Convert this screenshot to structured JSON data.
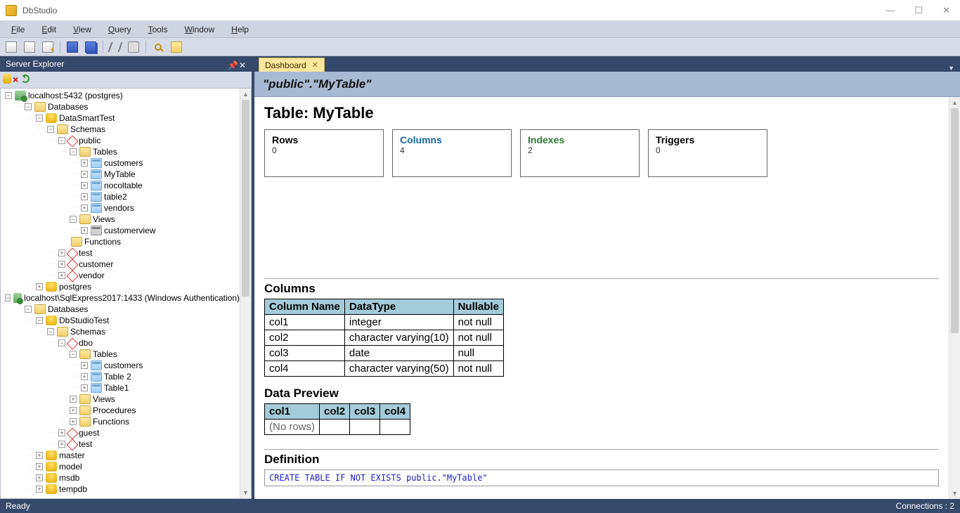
{
  "app": {
    "title": "DbStudio"
  },
  "menubar": [
    "File",
    "Edit",
    "View",
    "Query",
    "Tools",
    "Window",
    "Help"
  ],
  "explorer": {
    "title": "Server Explorer",
    "tree": [
      {
        "depth": 0,
        "toggle": "-",
        "icon": "server",
        "label": "localhost:5432 (postgres)"
      },
      {
        "depth": 1,
        "toggle": "-",
        "icon": "folder-open",
        "label": "Databases"
      },
      {
        "depth": 2,
        "toggle": "-",
        "icon": "db",
        "label": "DataSmartTest"
      },
      {
        "depth": 3,
        "toggle": "-",
        "icon": "folder-open",
        "label": "Schemas"
      },
      {
        "depth": 4,
        "toggle": "-",
        "icon": "schema",
        "label": "public"
      },
      {
        "depth": 5,
        "toggle": "-",
        "icon": "folder-open",
        "label": "Tables"
      },
      {
        "depth": 6,
        "toggle": "+",
        "icon": "table",
        "label": "customers"
      },
      {
        "depth": 6,
        "toggle": "+",
        "icon": "table",
        "label": "MyTable"
      },
      {
        "depth": 6,
        "toggle": "+",
        "icon": "table",
        "label": "nocoltable"
      },
      {
        "depth": 6,
        "toggle": "+",
        "icon": "table",
        "label": "table2"
      },
      {
        "depth": 6,
        "toggle": "+",
        "icon": "table",
        "label": "vendors"
      },
      {
        "depth": 5,
        "toggle": "-",
        "icon": "folder-open",
        "label": "Views"
      },
      {
        "depth": 6,
        "toggle": "+",
        "icon": "view",
        "label": "customerview"
      },
      {
        "depth": 5,
        "toggle": "",
        "icon": "folder",
        "label": "Functions"
      },
      {
        "depth": 4,
        "toggle": "+",
        "icon": "schema",
        "label": "test"
      },
      {
        "depth": 4,
        "toggle": "+",
        "icon": "schema",
        "label": "customer"
      },
      {
        "depth": 4,
        "toggle": "+",
        "icon": "schema",
        "label": "vendor"
      },
      {
        "depth": 2,
        "toggle": "+",
        "icon": "db",
        "label": "postgres"
      },
      {
        "depth": 0,
        "toggle": "-",
        "icon": "server",
        "label": "localhost\\SqlExpress2017:1433 (Windows Authentication)"
      },
      {
        "depth": 1,
        "toggle": "-",
        "icon": "folder-open",
        "label": "Databases"
      },
      {
        "depth": 2,
        "toggle": "-",
        "icon": "db",
        "label": "DbStudioTest"
      },
      {
        "depth": 3,
        "toggle": "-",
        "icon": "folder-open",
        "label": "Schemas"
      },
      {
        "depth": 4,
        "toggle": "-",
        "icon": "schema",
        "label": "dbo"
      },
      {
        "depth": 5,
        "toggle": "-",
        "icon": "folder-open",
        "label": "Tables"
      },
      {
        "depth": 6,
        "toggle": "+",
        "icon": "table",
        "label": "customers"
      },
      {
        "depth": 6,
        "toggle": "+",
        "icon": "table",
        "label": "Table 2"
      },
      {
        "depth": 6,
        "toggle": "+",
        "icon": "table",
        "label": "Table1"
      },
      {
        "depth": 5,
        "toggle": "+",
        "icon": "folder",
        "label": "Views"
      },
      {
        "depth": 5,
        "toggle": "+",
        "icon": "folder",
        "label": "Procedures"
      },
      {
        "depth": 5,
        "toggle": "+",
        "icon": "folder",
        "label": "Functions"
      },
      {
        "depth": 4,
        "toggle": "+",
        "icon": "schema",
        "label": "guest"
      },
      {
        "depth": 4,
        "toggle": "+",
        "icon": "schema",
        "label": "test"
      },
      {
        "depth": 2,
        "toggle": "+",
        "icon": "db",
        "label": "master"
      },
      {
        "depth": 2,
        "toggle": "+",
        "icon": "db",
        "label": "model"
      },
      {
        "depth": 2,
        "toggle": "+",
        "icon": "db",
        "label": "msdb"
      },
      {
        "depth": 2,
        "toggle": "+",
        "icon": "db",
        "label": "tempdb"
      }
    ]
  },
  "tab": {
    "label": "Dashboard"
  },
  "dashboard": {
    "breadcrumb": "\"public\".\"MyTable\"",
    "title": "Table: MyTable",
    "cards": {
      "rows": {
        "label": "Rows",
        "value": "0"
      },
      "columns": {
        "label": "Columns",
        "value": "4"
      },
      "indexes": {
        "label": "Indexes",
        "value": "2"
      },
      "triggers": {
        "label": "Triggers",
        "value": "0"
      }
    },
    "columns_section": {
      "title": "Columns",
      "headers": [
        "Column Name",
        "DataType",
        "Nullable"
      ],
      "rows": [
        [
          "col1",
          "integer",
          "not null"
        ],
        [
          "col2",
          "character varying(10)",
          "not null"
        ],
        [
          "col3",
          "date",
          "null"
        ],
        [
          "col4",
          "character varying(50)",
          "not null"
        ]
      ]
    },
    "preview": {
      "title": "Data Preview",
      "headers": [
        "col1",
        "col2",
        "col3",
        "col4"
      ],
      "empty_text": "(No rows)"
    },
    "definition": {
      "title": "Definition",
      "sql": "CREATE TABLE IF NOT EXISTS public.\"MyTable\""
    }
  },
  "statusbar": {
    "left": "Ready",
    "right": "Connections : 2"
  }
}
